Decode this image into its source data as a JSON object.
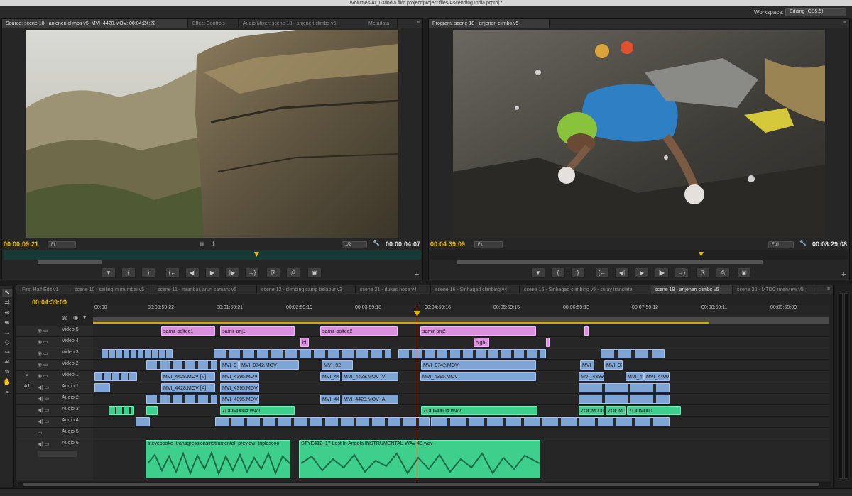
{
  "window": {
    "title": "/Volumes/AI_03/india film project/project files/Ascending India.prproj *"
  },
  "workspace": {
    "label": "Workspace:",
    "value": "Editing (CS5.5)"
  },
  "source_panel": {
    "tabs": [
      "Source: scene 18 - anjeneri climbs v5: MVI_4420.MOV: 00:04:24:22",
      "Effect Controls",
      "Audio Mixer: scene 18 - anjeneri climbs v5",
      "Metadata"
    ],
    "timecode": "00:00:09:21",
    "fit": "Fit",
    "ratio": "1/2",
    "duration": "00:00:04:07"
  },
  "program_panel": {
    "tabs": [
      "Program: scene 18 - anjeneri climbs v5"
    ],
    "timecode": "00:04:39:09",
    "fit": "Fit",
    "quality": "Full",
    "duration": "00:08:29:08"
  },
  "controls": {
    "buttons": [
      "▼",
      "{",
      "}",
      "{←",
      "◀|",
      "▶",
      "|▶",
      "→}",
      "⎘",
      "⎙",
      "▣"
    ],
    "add": "+"
  },
  "sequence_tabs": [
    "First Half Edit v1",
    "scene 10 - sailing in mumbai v5",
    "scene 11 - mumbai, arun samant v5",
    "scene 12 - climbing camp belapur v3",
    "scene 21 - dukes nose v4",
    "scene 16 - Sinhagad climbing v4",
    "scene 16 - Sinhagad climbing v5 - sujay translate",
    "scene 18 - anjeneri climbs v5",
    "scene 20 - MTDC interview v5"
  ],
  "timeline": {
    "timecode": "00:04:39:09",
    "ruler": [
      "00:00",
      "00:00:59:22",
      "00:01:59:21",
      "00:02:59:19",
      "00:03:59:18",
      "00:04:59:16",
      "00:05:59:15",
      "00:06:59:13",
      "00:07:59:12",
      "00:08:59:11",
      "00:09:59:09"
    ],
    "tracks": [
      {
        "name": "Video 5",
        "target": ""
      },
      {
        "name": "Video 4",
        "target": ""
      },
      {
        "name": "Video 3",
        "target": ""
      },
      {
        "name": "Video 2",
        "target": ""
      },
      {
        "name": "Video 1",
        "target": "V"
      },
      {
        "name": "Audio 1",
        "target": "A1"
      },
      {
        "name": "Audio 2",
        "target": ""
      },
      {
        "name": "Audio 3",
        "target": ""
      },
      {
        "name": "Audio 4",
        "target": ""
      },
      {
        "name": "Audio 5",
        "target": ""
      },
      {
        "name": "Audio 6",
        "target": ""
      }
    ],
    "clips": {
      "v5": [
        "samir-bolted1",
        "samir-anj1",
        "samir-bolted2",
        "samir-anj2"
      ],
      "v4": [
        "hi",
        "high-"
      ],
      "v2": [
        "MVI_9",
        "MVI_9742.MOV",
        "MVI_92",
        "MVI_9742.MOV",
        "MVI_9",
        "MVI_97"
      ],
      "v1": [
        "MVI_4428.MOV [V]",
        "MVI_4395.MOV",
        "MVI_44",
        "MVI_4428.MOV [V]",
        "MVI_4395.MOV",
        "MVI_4399",
        "MVI_43",
        "MVI_4400"
      ],
      "a1": [
        "MVI_4428.MOV [A]",
        "MVI_4395.MOV"
      ],
      "a2": [
        "MVI_4395.MOV",
        "MVI_44",
        "MVI_4428.MOV [A]"
      ],
      "a3": [
        "ZOOM0004.WAV",
        "ZOOM0004.WAV",
        "ZOOM000",
        "ZOOM0",
        "ZOOM000"
      ],
      "a6": [
        "stevebooke_transgressionsinstrumental_preview_triplescoo",
        "STYE412_17 Lost In Angola INSTRUMENTAL-WAV-48.wav"
      ]
    }
  },
  "colors": {
    "timecode": "#e8b800",
    "video_clip": "#7fa4d6",
    "title_clip": "#dc8fe1",
    "audio_clip": "#3fcf8c",
    "playhead": "#e04b1e"
  }
}
